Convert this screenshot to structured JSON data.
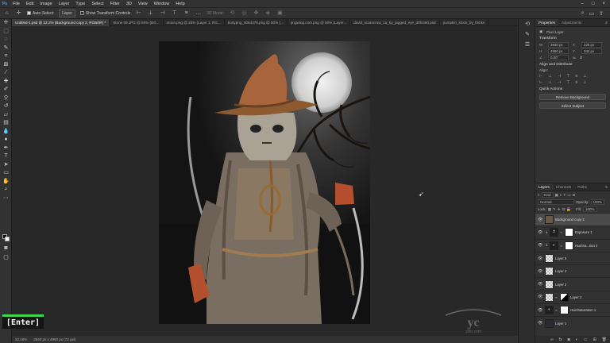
{
  "app": {
    "logo": "Ps"
  },
  "menu": {
    "items": [
      "File",
      "Edit",
      "Image",
      "Layer",
      "Type",
      "Select",
      "Filter",
      "3D",
      "View",
      "Window",
      "Help"
    ]
  },
  "options": {
    "auto_select_label": "Auto-Select:",
    "auto_select_target": "Layer",
    "show_transform_label": "Show Transform Controls",
    "mode_3d": "3D Mode:"
  },
  "tabs": [
    {
      "label": "Untitled-1.psd @ 22.2% (Background copy 2, RGB/8#) *",
      "active": true
    },
    {
      "label": "Stone 09.JPG @ 50% (BG...",
      "active": false
    },
    {
      "label": "moon.png @ 25% (Layer 1, RG...",
      "active": false
    },
    {
      "label": "bodypng_5064375.png @ 50% (...",
      "active": false
    },
    {
      "label": "pngwing.com.png @ 50% (Layer...",
      "active": false
    },
    {
      "label": "david_scarecrow_1a_by_jagged_eye_d0hi490.psd",
      "active": false
    },
    {
      "label": "pumpkin_stock_by_thinks",
      "active": false
    }
  ],
  "status": {
    "zoom": "22.18%",
    "doc_size": "3840 px x 4960 px (72 ppi)"
  },
  "overlay": {
    "key_label": "[Enter]"
  },
  "properties": {
    "tabs": [
      "Properties",
      "Adjustments"
    ],
    "kind": "Pixel Layer",
    "transform_title": "Transform",
    "w_label": "W",
    "w_value": "3840 px",
    "h_label": "H",
    "h_value": "4960 px",
    "x_label": "X",
    "x_value": "225 px",
    "y_label": "Y",
    "y_value": "342 px",
    "angle_value": "0.00°",
    "align_title": "Align and Distribute",
    "align_label": "Align:",
    "quick_actions_title": "Quick Actions",
    "remove_bg_label": "Remove Background",
    "select_subject_label": "Select Subject"
  },
  "layers_panel": {
    "tabs": [
      "Layers",
      "Channels",
      "Paths"
    ],
    "kind_label": "Kind",
    "blend_mode": "Normal",
    "opacity_label": "Opacity:",
    "opacity_value": "100%",
    "lock_label": "Lock:",
    "fill_label": "Fill:",
    "fill_value": "100%",
    "layers": [
      {
        "name": "Background copy 2",
        "type": "dark",
        "selected": true
      },
      {
        "name": "Exposure 1",
        "type": "adj",
        "selected": false
      },
      {
        "name": "Hue/Sa...tion 2",
        "type": "adj",
        "selected": false
      },
      {
        "name": "Layer 5",
        "type": "pixel",
        "selected": false
      },
      {
        "name": "Layer 4",
        "type": "pixel",
        "selected": false
      },
      {
        "name": "Layer 2",
        "type": "pixel",
        "selected": false
      },
      {
        "name": "Layer 3",
        "type": "pixel",
        "selected": false
      },
      {
        "name": "Hue/Saturation 1",
        "type": "adj",
        "selected": false
      },
      {
        "name": "Layer 1",
        "type": "dark",
        "selected": false
      }
    ]
  },
  "watermark": {
    "text": "yloo.com"
  },
  "colors": {
    "accent": "#31a8ff",
    "panel": "#323232",
    "canvas_bg": "#282828",
    "moon": "#e8e8e8",
    "coat": "#a8643a"
  }
}
